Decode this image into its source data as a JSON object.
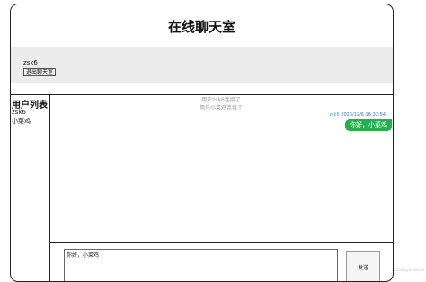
{
  "header": {
    "title": "在线聊天室"
  },
  "user_bar": {
    "current_user": "zsk6",
    "logout_label": "退出聊天室"
  },
  "user_list": {
    "title": "用户列表",
    "users": [
      "zsk6",
      "小菜鸡"
    ]
  },
  "chat": {
    "system_messages": [
      "用户zsk6连接了",
      "用户小菜鸡连接了"
    ],
    "message": {
      "user": "zsk6",
      "time": "2023/12/6 16:32:54",
      "text": "你好，小菜鸡"
    }
  },
  "composer": {
    "input_value": "你好，小菜鸡",
    "send_label": "发送"
  },
  "watermark": "CSDN @Hiiiiiiiiiiiii",
  "colors": {
    "bubble": "#22b14c",
    "meta_user": "#2aa9c8",
    "meta_time": "#2979d8",
    "user_bar_bg": "#ececec"
  }
}
